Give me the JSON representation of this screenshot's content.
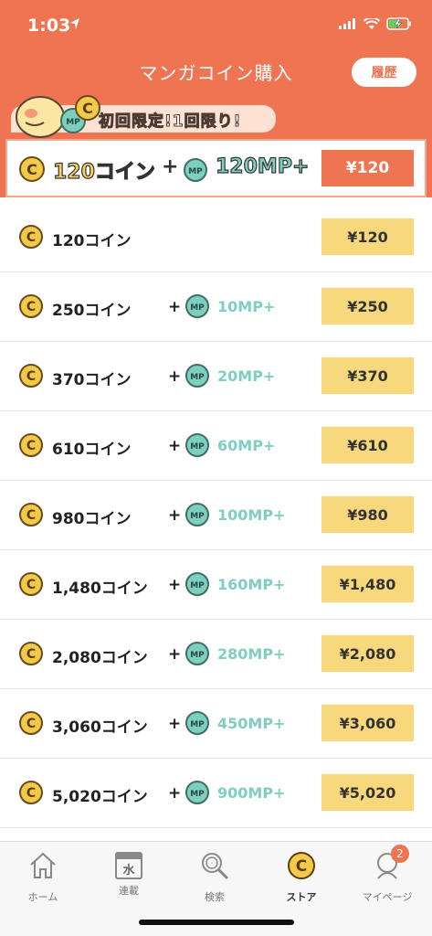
{
  "status_bar": {
    "time": "1:03"
  },
  "header": {
    "title": "マンガコイン購入",
    "history_label": "履歴"
  },
  "promo": {
    "tab_text": "初回限定!1回限り!",
    "coins": "120コイン",
    "plus": "+",
    "mp": "120MP+",
    "price": "¥120",
    "mascot_icon": "mascot-with-coins-icon"
  },
  "items": [
    {
      "coins": "120コイン",
      "mp": "",
      "price": "¥120"
    },
    {
      "coins": "250コイン",
      "mp": "10MP+",
      "price": "¥250"
    },
    {
      "coins": "370コイン",
      "mp": "20MP+",
      "price": "¥370"
    },
    {
      "coins": "610コイン",
      "mp": "60MP+",
      "price": "¥610"
    },
    {
      "coins": "980コイン",
      "mp": "100MP+",
      "price": "¥980"
    },
    {
      "coins": "1,480コイン",
      "mp": "160MP+",
      "price": "¥1,480"
    },
    {
      "coins": "2,080コイン",
      "mp": "280MP+",
      "price": "¥2,080"
    },
    {
      "coins": "3,060コイン",
      "mp": "450MP+",
      "price": "¥3,060"
    },
    {
      "coins": "5,020コイン",
      "mp": "900MP+",
      "price": "¥5,020"
    }
  ],
  "plus_sign": "+",
  "tabs": [
    {
      "label": "ホーム",
      "icon": "home-icon"
    },
    {
      "label": "連載",
      "icon": "calendar-icon",
      "icon_text": "水"
    },
    {
      "label": "検索",
      "icon": "search-icon"
    },
    {
      "label": "ストア",
      "icon": "coin-icon",
      "active": true
    },
    {
      "label": "マイページ",
      "icon": "profile-icon",
      "badge": "2"
    }
  ],
  "colors": {
    "brand": "#EE7452",
    "price_bg": "#F8D87C",
    "mp_text": "#7ECFC0",
    "coin": "#F3C94A"
  }
}
